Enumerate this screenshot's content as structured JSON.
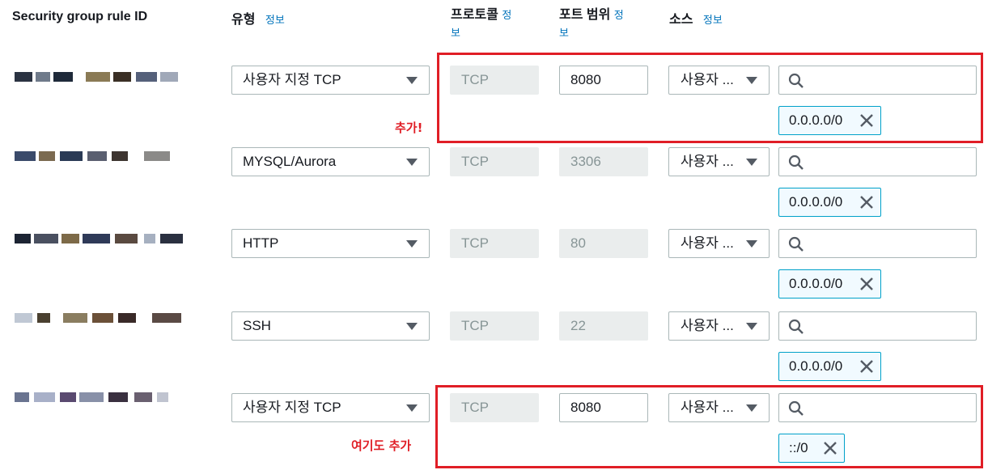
{
  "headers": {
    "rule_id": "Security group rule ID",
    "type": "유형",
    "type_info": "정보",
    "protocol_1": "프로토콜",
    "protocol_info_1": "정",
    "protocol_info_2": "보",
    "port_1": "포트 범위",
    "port_info_1": "정",
    "port_info_2": "보",
    "source": "소스",
    "source_info": "정보"
  },
  "rules": [
    {
      "type": "사용자 지정 TCP",
      "protocol": "TCP",
      "port": "8080",
      "source": "사용자 ...",
      "cidr": "0.0.0.0/0"
    },
    {
      "type": "MYSQL/Aurora",
      "protocol": "TCP",
      "port": "3306",
      "source": "사용자 ...",
      "cidr": "0.0.0.0/0"
    },
    {
      "type": "HTTP",
      "protocol": "TCP",
      "port": "80",
      "source": "사용자 ...",
      "cidr": "0.0.0.0/0"
    },
    {
      "type": "SSH",
      "protocol": "TCP",
      "port": "22",
      "source": "사용자 ...",
      "cidr": "0.0.0.0/0"
    },
    {
      "type": "사용자 지정 TCP",
      "protocol": "TCP",
      "port": "8080",
      "source": "사용자 ...",
      "cidr": "::/0"
    }
  ],
  "annotations": {
    "note_1": "추가!",
    "note_2": "여기도 추가"
  },
  "icons": {
    "search": "search-icon",
    "remove": "close-icon"
  },
  "colors": {
    "highlight": "#e01e26",
    "info_link": "#0073bb",
    "token_border": "#00a1c9"
  }
}
